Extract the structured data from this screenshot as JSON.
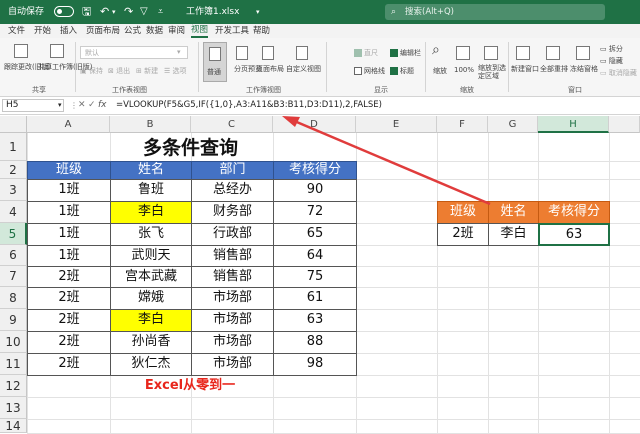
{
  "titlebar": {
    "autosave": "自动保存",
    "filename": "工作簿1.xlsx",
    "search_placeholder": "搜索(Alt+Q)"
  },
  "menu": [
    "文件",
    "开始",
    "插入",
    "页面布局",
    "公式",
    "数据",
    "审阅",
    "视图",
    "开发工具",
    "帮助"
  ],
  "menu_active_index": 7,
  "ribbon": {
    "sheetview": {
      "dropdown": "默认",
      "keep": "保持",
      "exit": "退出",
      "new": "新建",
      "options": "选项",
      "label": "工作表视图"
    },
    "share": {
      "btn1": "跟踪更改(旧版)",
      "btn2": "共享工作簿(旧版)",
      "label": "共享"
    },
    "wbview": {
      "normal": "普通",
      "pagebreak": "分页预览",
      "pagelayout": "页面布局",
      "custom": "自定义视图",
      "label": "工作簿视图"
    },
    "show": {
      "ruler": "直尺",
      "formulabar": "编辑栏",
      "gridlines": "网格线",
      "headings": "标题",
      "label": "显示"
    },
    "zoom": {
      "zoom": "缩放",
      "hundred": "100%",
      "selection": "缩放到选定区域",
      "label": "缩放"
    },
    "window": {
      "newwin": "新建窗口",
      "arrange": "全部重排",
      "freeze": "冻结窗格",
      "split": "拆分",
      "hide": "隐藏",
      "unhide": "取消隐藏",
      "label": "窗口"
    }
  },
  "formula_bar": {
    "namebox": "H5",
    "fx": "fx",
    "formula": "=VLOOKUP(F5&G5,IF({1,0},A3:A11&B3:B11,D3:D11),2,FALSE)"
  },
  "columns": [
    "A",
    "B",
    "C",
    "D",
    "E",
    "F",
    "G",
    "H"
  ],
  "rows": [
    "1",
    "2",
    "3",
    "4",
    "5",
    "6",
    "7",
    "8",
    "9",
    "10",
    "11",
    "12",
    "13",
    "14"
  ],
  "selected": {
    "column": "H",
    "row": "5"
  },
  "main_table": {
    "title": "多条件查询",
    "headers": [
      "班级",
      "姓名",
      "部门",
      "考核得分"
    ],
    "rows": [
      [
        "1班",
        "鲁班",
        "总经办",
        "90"
      ],
      [
        "1班",
        "李白",
        "财务部",
        "72"
      ],
      [
        "1班",
        "张飞",
        "行政部",
        "65"
      ],
      [
        "1班",
        "武则天",
        "销售部",
        "64"
      ],
      [
        "2班",
        "宫本武藏",
        "销售部",
        "75"
      ],
      [
        "2班",
        "嫦娥",
        "市场部",
        "61"
      ],
      [
        "2班",
        "李白",
        "市场部",
        "63"
      ],
      [
        "2班",
        "孙尚香",
        "市场部",
        "88"
      ],
      [
        "2班",
        "狄仁杰",
        "市场部",
        "98"
      ]
    ],
    "highlight_rows": [
      1,
      6
    ]
  },
  "lookup_table": {
    "headers": [
      "班级",
      "姓名",
      "考核得分"
    ],
    "values": [
      "2班",
      "李白",
      "63"
    ]
  },
  "watermark": "Excel从零到一",
  "colors": {
    "title_bar": "#1f7145",
    "header_blue": "#4472c4",
    "header_orange": "#ed7d31",
    "highlight": "#ffff00",
    "arrow": "#e03c3c",
    "watermark": "#e8261c"
  }
}
